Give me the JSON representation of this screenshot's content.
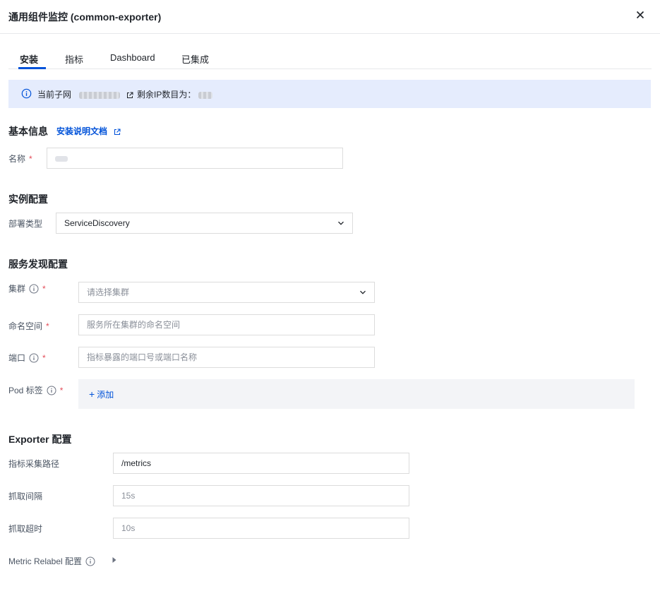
{
  "header": {
    "title": "通用组件监控 (common-exporter)",
    "close_icon": "close-icon"
  },
  "tabs": [
    {
      "label": "安装",
      "active": true
    },
    {
      "label": "指标",
      "active": false
    },
    {
      "label": "Dashboard",
      "active": false
    },
    {
      "label": "已集成",
      "active": false
    }
  ],
  "notice": {
    "prefix": "当前子网",
    "remaining": "剩余IP数目为：",
    "icon": "info-icon",
    "background": "#e5ecfd"
  },
  "basic": {
    "title": "基本信息",
    "doc_link": "安装说明文档",
    "name_label": "名称"
  },
  "instance": {
    "title": "实例配置",
    "deploy_label": "部署类型",
    "deploy_value": "ServiceDiscovery"
  },
  "discovery": {
    "title": "服务发现配置",
    "cluster_label": "集群",
    "cluster_placeholder": "请选择集群",
    "namespace_label": "命名空间",
    "namespace_placeholder": "服务所在集群的命名空间",
    "port_label": "端口",
    "port_placeholder": "指标暴露的端口号或端口名称",
    "pod_label": "Pod 标签",
    "add_label": "添加"
  },
  "exporter": {
    "title": "Exporter 配置",
    "path_label": "指标采集路径",
    "path_value": "/metrics",
    "interval_label": "抓取间隔",
    "interval_placeholder": "15s",
    "timeout_label": "抓取超时",
    "timeout_placeholder": "10s",
    "relabel_label": "Metric Relabel 配置"
  },
  "colors": {
    "accent": "#0052d9",
    "required": "#e34d59"
  }
}
